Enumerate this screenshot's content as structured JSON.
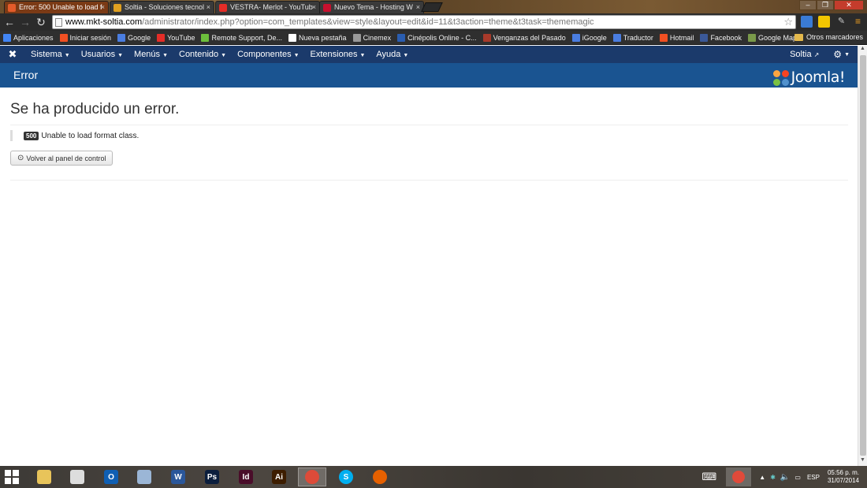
{
  "browser": {
    "tabs": [
      {
        "title": "Error: 500 Unable to load f",
        "active": true,
        "favicon_color": "#e35b2a"
      },
      {
        "title": "Soltia - Soluciones tecnol",
        "active": false,
        "favicon_color": "#e0a020"
      },
      {
        "title": "VESTRA- Merlot - YouTub",
        "active": false,
        "favicon_color": "#e52d27"
      },
      {
        "title": "Nuevo Tema - Hosting W",
        "active": false,
        "favicon_color": "#c8102e"
      }
    ],
    "tab_close_glyph": "×",
    "url_host": "www.mkt-soltia.com",
    "url_path": "/administrator/index.php?option=com_templates&view=style&layout=edit&id=11&t3action=theme&t3task=thememagic",
    "bookmarks": [
      {
        "label": "Aplicaciones",
        "icon_color": "#4285f4"
      },
      {
        "label": "Iniciar sesión",
        "icon_color": "#f25022"
      },
      {
        "label": "Google",
        "icon_color": "#4a7de0"
      },
      {
        "label": "YouTube",
        "icon_color": "#e52d27"
      },
      {
        "label": "Remote Support, De...",
        "icon_color": "#6cbf3c"
      },
      {
        "label": "Nueva pestaña",
        "icon_color": "#ffffff"
      },
      {
        "label": "Cinemex",
        "icon_color": "#999999"
      },
      {
        "label": "Cinépolis Online - C...",
        "icon_color": "#2a5db0"
      },
      {
        "label": "Venganzas del Pasado",
        "icon_color": "#a83a2a"
      },
      {
        "label": "iGoogle",
        "icon_color": "#4a7de0"
      },
      {
        "label": "Traductor",
        "icon_color": "#4a7de0"
      },
      {
        "label": "Hotmail",
        "icon_color": "#f25022"
      },
      {
        "label": "Facebook",
        "icon_color": "#3b5998"
      },
      {
        "label": "Google Maps",
        "icon_color": "#7a9a4a"
      }
    ],
    "other_bookmarks": "Otros marcadores"
  },
  "joomla": {
    "menu": [
      {
        "label": "Sistema"
      },
      {
        "label": "Usuarios"
      },
      {
        "label": "Menús"
      },
      {
        "label": "Contenido"
      },
      {
        "label": "Componentes"
      },
      {
        "label": "Extensiones"
      },
      {
        "label": "Ayuda"
      }
    ],
    "site_link": "Soltia",
    "page_header": "Error",
    "brand": "Joomla!",
    "error_title": "Se ha producido un error.",
    "error_code": "500",
    "error_message": "Unable to load format class.",
    "back_button": "Volver al panel de control"
  },
  "taskbar": {
    "language": "ESP",
    "time": "05:56 p. m.",
    "date": "31/07/2014",
    "apps": [
      {
        "name": "explorer",
        "glyph": "",
        "color": "#e8c45a"
      },
      {
        "name": "apps-grid",
        "glyph": "",
        "color": "#dddddd"
      },
      {
        "name": "outlook",
        "glyph": "O",
        "color": "#0f5fb3"
      },
      {
        "name": "paint",
        "glyph": "",
        "color": "#9bb6d6"
      },
      {
        "name": "word",
        "glyph": "W",
        "color": "#2b579a"
      },
      {
        "name": "photoshop",
        "glyph": "Ps",
        "color": "#0b1e3d"
      },
      {
        "name": "indesign",
        "glyph": "Id",
        "color": "#4a0d2a"
      },
      {
        "name": "illustrator",
        "glyph": "Ai",
        "color": "#3d1d00"
      },
      {
        "name": "chrome",
        "glyph": "",
        "color": "#dd4b39"
      },
      {
        "name": "skype",
        "glyph": "S",
        "color": "#00aff0"
      },
      {
        "name": "firefox",
        "glyph": "",
        "color": "#e66000"
      }
    ]
  },
  "colors": {
    "nav_bg": "#1b3a6b",
    "header_bg": "#1a5491",
    "error_badge": "#333333"
  }
}
